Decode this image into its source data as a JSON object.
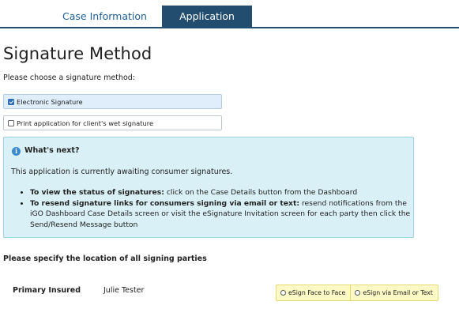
{
  "tabs": [
    {
      "label": "Case Information",
      "active": false
    },
    {
      "label": "Application",
      "active": true
    }
  ],
  "colors": {
    "tab_active_bg": "#234d6e",
    "tab_inactive_text": "#1f5e95",
    "info_bg": "#daf0f7",
    "selected_option_bg": "#dfeefa",
    "esign_bg": "#fdf9c4"
  },
  "page": {
    "title": "Signature Method",
    "prompt": "Please choose a signature method:"
  },
  "signature_options": [
    {
      "label": "Electronic Signature",
      "checked": true
    },
    {
      "label": "Print application for client's wet signature",
      "checked": false
    }
  ],
  "info": {
    "icon": "info-icon",
    "title": "What's next?",
    "text": "This application is currently awaiting consumer signatures.",
    "bullets": [
      {
        "bold": "To view the status of signatures:",
        "rest": " click on the Case Details button from the Dashboard"
      },
      {
        "bold": "To resend signature links for consumers signing via email or text:",
        "rest": " resend notifications from the iGO Dashboard Case Details screen or visit the eSignature Invitation screen for each party then click the Send/Resend Message button"
      }
    ]
  },
  "location_label": "Please specify the location of all signing parties",
  "party": {
    "role": "Primary Insured",
    "name": "Julie Tester",
    "options": [
      {
        "label": "eSign Face to Face",
        "selected": false
      },
      {
        "label": "eSign via Email or Text",
        "selected": false
      }
    ]
  }
}
